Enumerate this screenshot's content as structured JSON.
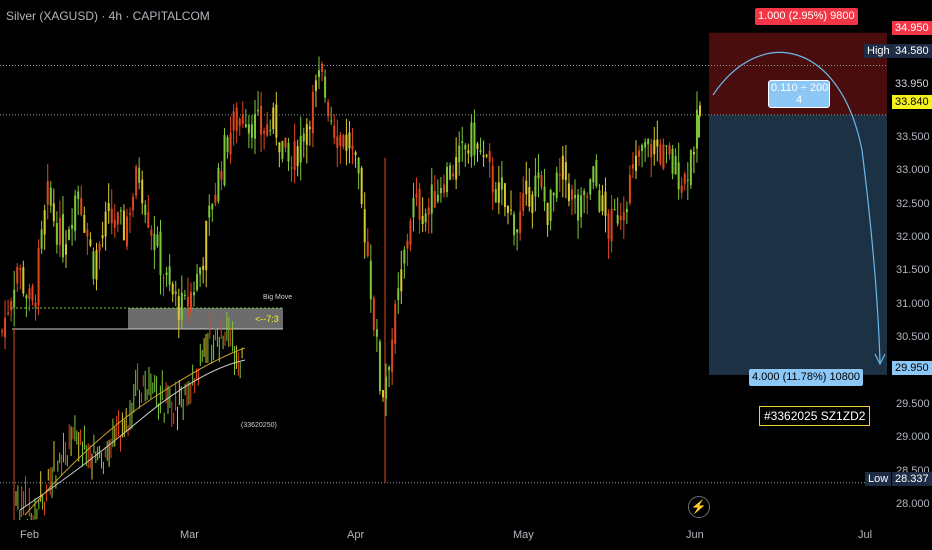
{
  "header": {
    "title": "Silver (XAGUSD) · 4h · CAPITALCOM"
  },
  "chart_data": {
    "type": "candlestick",
    "symbol": "Silver (XAGUSD)",
    "interval": "4h",
    "source": "CAPITALCOM",
    "x_ticks": [
      "Feb",
      "Mar",
      "Apr",
      "May",
      "Jun",
      "Jul"
    ],
    "y_ticks": [
      "28.000",
      "28.500",
      "29.000",
      "29.500",
      "30.000",
      "30.500",
      "31.000",
      "31.500",
      "32.000",
      "32.500",
      "33.000",
      "33.500",
      "34.000"
    ],
    "ylim": [
      27.75,
      35.35
    ],
    "price_path": [
      {
        "t": "Feb",
        "p": 30.6
      },
      {
        "t": "Feb",
        "p": 31.6
      },
      {
        "t": "Feb",
        "p": 30.9
      },
      {
        "t": "Feb",
        "p": 32.6
      },
      {
        "t": "Feb",
        "p": 31.9
      },
      {
        "t": "Feb",
        "p": 32.8
      },
      {
        "t": "Feb",
        "p": 31.6
      },
      {
        "t": "Feb",
        "p": 32.3
      },
      {
        "t": "Feb",
        "p": 32.1
      },
      {
        "t": "Feb",
        "p": 33.0
      },
      {
        "t": "Feb",
        "p": 32.0
      },
      {
        "t": "Feb",
        "p": 31.2
      },
      {
        "t": "Mar",
        "p": 30.9
      },
      {
        "t": "Mar",
        "p": 31.5
      },
      {
        "t": "Mar",
        "p": 32.7
      },
      {
        "t": "Mar",
        "p": 33.6
      },
      {
        "t": "Mar",
        "p": 33.9
      },
      {
        "t": "Mar",
        "p": 33.6
      },
      {
        "t": "Mar",
        "p": 33.7
      },
      {
        "t": "Mar",
        "p": 33.0
      },
      {
        "t": "Mar",
        "p": 33.7
      },
      {
        "t": "Mar",
        "p": 34.4
      },
      {
        "t": "Mar",
        "p": 33.6
      },
      {
        "t": "Apr",
        "p": 33.4
      },
      {
        "t": "Apr",
        "p": 32.0
      },
      {
        "t": "Apr",
        "p": 29.6
      },
      {
        "t": "Apr",
        "p": 30.9
      },
      {
        "t": "Apr",
        "p": 32.5
      },
      {
        "t": "Apr",
        "p": 32.4
      },
      {
        "t": "Apr",
        "p": 32.9
      },
      {
        "t": "Apr",
        "p": 33.1
      },
      {
        "t": "Apr",
        "p": 33.5
      },
      {
        "t": "Apr",
        "p": 33.0
      },
      {
        "t": "May",
        "p": 32.5
      },
      {
        "t": "May",
        "p": 32.2
      },
      {
        "t": "May",
        "p": 32.9
      },
      {
        "t": "May",
        "p": 32.4
      },
      {
        "t": "May",
        "p": 33.0
      },
      {
        "t": "May",
        "p": 32.3
      },
      {
        "t": "May",
        "p": 32.9
      },
      {
        "t": "May",
        "p": 32.1
      },
      {
        "t": "May",
        "p": 32.6
      },
      {
        "t": "May",
        "p": 33.2
      },
      {
        "t": "May",
        "p": 33.4
      },
      {
        "t": "May",
        "p": 33.1
      },
      {
        "t": "Jun",
        "p": 32.9
      },
      {
        "t": "Jun",
        "p": 33.84
      }
    ],
    "horizontal_levels": [
      {
        "label": "High",
        "value": 34.58,
        "text": "34.580"
      },
      {
        "label": "",
        "value": 33.84,
        "text": "33.840"
      },
      {
        "label": "Low",
        "value": 28.337,
        "text": "28.337"
      }
    ],
    "position_tool": {
      "entry": 33.95,
      "entry_text": "33.950",
      "target": 29.95,
      "target_text": "29.950",
      "stop": 34.95,
      "stop_text": "34.950",
      "stop_label": "1.000 (2.95%) 9800",
      "target_label": "4.000 (11.78%) 10800",
      "ratio_label_line1": "0.110 ÷ 200",
      "ratio_label_line2": "4"
    },
    "inset": {
      "zone_label": "Big Move",
      "zone_text": "<--7:3",
      "caption": "(33620250)"
    },
    "watermark": "#3362025 SZ1ZD2",
    "colors": {
      "background": "#000000",
      "up": "#7ec73b",
      "down": "#e0471e",
      "neutral": "#d9c92e",
      "stop_zone": "#4a0d0d",
      "target_zone": "#1c3144",
      "high_label": "#1e2c45",
      "current_price": "#f5f11f",
      "stop_badge": "#f23645",
      "target_badge": "#8cc7f5",
      "curve": "#6ab7e8"
    }
  },
  "labels": {
    "high_tag": "High",
    "low_tag": "Low",
    "stop_badge": "1.000 (2.95%) 9800",
    "target_badge": "4.000 (11.78%) 10800",
    "watermark": "#3362025 SZ1ZD2"
  }
}
